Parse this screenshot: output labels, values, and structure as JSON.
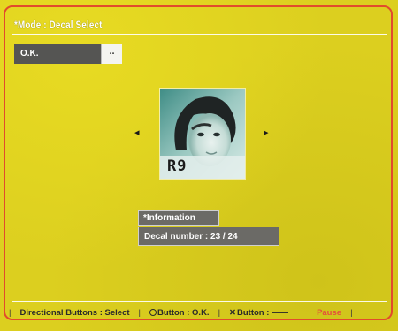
{
  "header": {
    "mode_title": "*Mode : Decal Select"
  },
  "selection": {
    "field_label": "O.K.",
    "field_button": ".."
  },
  "decal": {
    "image_caption": "R9",
    "prev_arrow": "◂",
    "next_arrow": "▸"
  },
  "info": {
    "heading": "*Information",
    "decal_number_text": "Decal number : 23 / 24"
  },
  "help_bar": {
    "directional": "Directional Buttons : Select",
    "circle_button": "Button : O.K.",
    "x_button": "Button : ——",
    "right_label": "Pause"
  },
  "colors": {
    "background": "#dccf1f",
    "frame_border": "#e24b2c",
    "panel_gray": "#6b6a66",
    "accent_red": "#e4533a"
  }
}
